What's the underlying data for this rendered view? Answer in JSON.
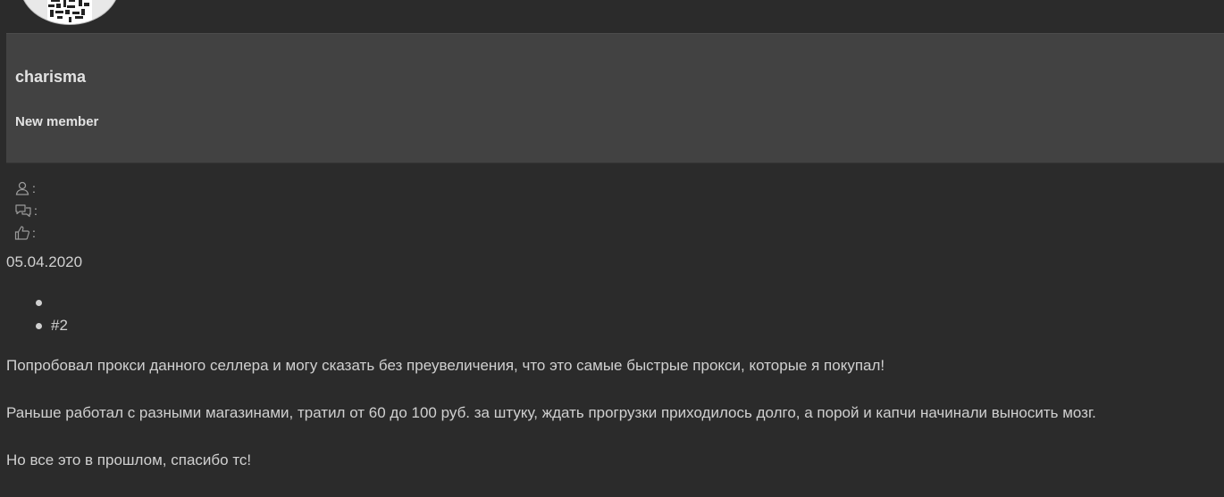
{
  "user": {
    "name": "charisma",
    "title": "New member",
    "stats": [
      {
        "icon": "user-icon",
        "label": ":"
      },
      {
        "icon": "messages-icon",
        "label": ":"
      },
      {
        "icon": "thumbs-up-icon",
        "label": ":"
      }
    ]
  },
  "post": {
    "date": "05.04.2020",
    "actions": [
      "",
      "#2"
    ],
    "paragraphs": [
      "Попробовал прокси данного селлера и могу сказать без преувеличения, что это самые быстрые прокси, которые я покупал!",
      "Раньше работал с разными магазинами, тратил от 60 до 100 руб. за штуку, ждать прогрузки приходилось долго, а порой и капчи начинали выносить мозг.",
      "Но все это в прошлом, спасибо тс!"
    ]
  }
}
